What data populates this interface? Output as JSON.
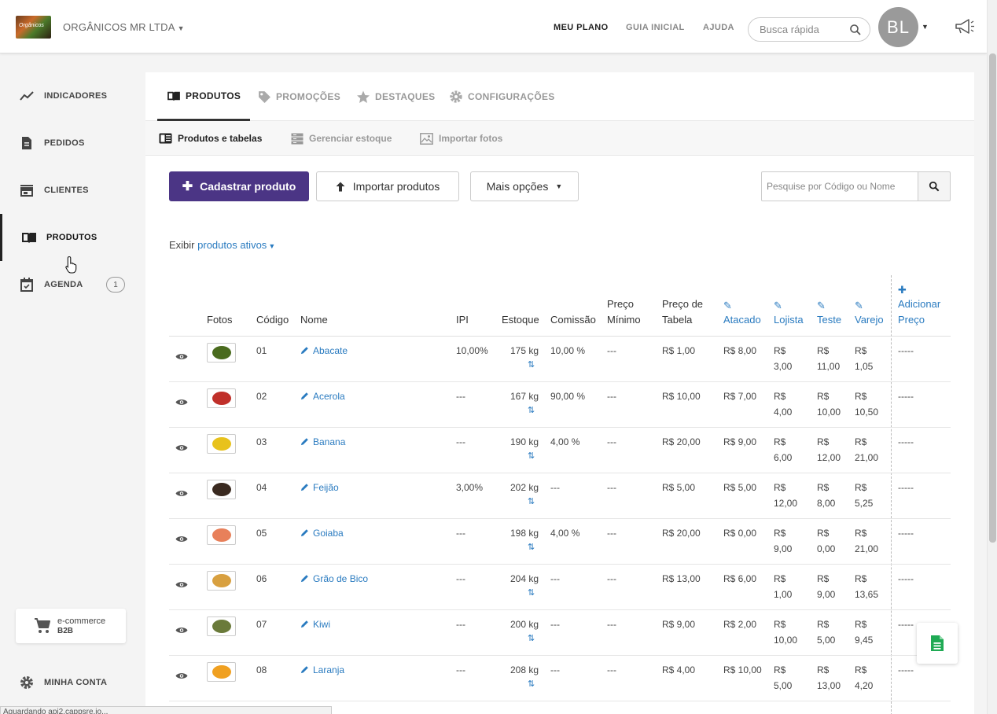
{
  "header": {
    "company": "ORGÂNICOS MR LTDA",
    "logo_text": "Orgânicos",
    "nav": [
      "MEU PLANO",
      "GUIA INICIAL",
      "AJUDA"
    ],
    "search_placeholder": "Busca rápida",
    "avatar_initials": "BL"
  },
  "sidebar": {
    "items": [
      {
        "label": "INDICADORES",
        "icon": "chart-line-icon"
      },
      {
        "label": "PEDIDOS",
        "icon": "document-icon"
      },
      {
        "label": "CLIENTES",
        "icon": "store-icon"
      },
      {
        "label": "PRODUTOS",
        "icon": "book-icon"
      },
      {
        "label": "AGENDA",
        "icon": "calendar-icon",
        "badge": "1"
      }
    ],
    "ecommerce": {
      "line1": "e-commerce",
      "line2": "B2B"
    },
    "account": "MINHA CONTA"
  },
  "tabs": [
    "PRODUTOS",
    "PROMOÇÕES",
    "DESTAQUES",
    "CONFIGURAÇÕES"
  ],
  "subtabs": [
    "Produtos e tabelas",
    "Gerenciar estoque",
    "Importar fotos"
  ],
  "actions": {
    "new_product": "Cadastrar produto",
    "import_products": "Importar produtos",
    "more_options": "Mais opções",
    "search_placeholder": "Pesquise por Código ou Nome"
  },
  "filter": {
    "prefix": "Exibir",
    "value": "produtos ativos"
  },
  "table": {
    "headers": {
      "photos": "Fotos",
      "code": "Código",
      "name": "Nome",
      "ipi": "IPI",
      "stock": "Estoque",
      "commission": "Comissão",
      "min_price_1": "Preço",
      "min_price_2": "Mínimo",
      "table_price_1": "Preço de",
      "table_price_2": "Tabela",
      "atacado": "Atacado",
      "lojista": "Lojista",
      "teste": "Teste",
      "varejo": "Varejo",
      "add_price_1": "Adicionar",
      "add_price_2": "Preço"
    },
    "rows": [
      {
        "code": "01",
        "name": "Abacate",
        "ipi": "10,00%",
        "stock": "175 kg",
        "commission": "10,00 %",
        "min": "---",
        "table": "R$ 1,00",
        "atacado": "R$ 8,00",
        "lojista_1": "R$",
        "lojista_2": "3,00",
        "teste_1": "R$",
        "teste_2": "11,00",
        "varejo_1": "R$",
        "varejo_2": "1,05",
        "extra": "-----",
        "color": "#4a6b1e"
      },
      {
        "code": "02",
        "name": "Acerola",
        "ipi": "---",
        "stock": "167 kg",
        "commission": "90,00 %",
        "min": "---",
        "table": "R$ 10,00",
        "atacado": "R$ 7,00",
        "lojista_1": "R$",
        "lojista_2": "4,00",
        "teste_1": "R$",
        "teste_2": "10,00",
        "varejo_1": "R$",
        "varejo_2": "10,50",
        "extra": "-----",
        "color": "#c0302a"
      },
      {
        "code": "03",
        "name": "Banana",
        "ipi": "---",
        "stock": "190 kg",
        "commission": "4,00 %",
        "min": "---",
        "table": "R$ 20,00",
        "atacado": "R$ 9,00",
        "lojista_1": "R$",
        "lojista_2": "6,00",
        "teste_1": "R$",
        "teste_2": "12,00",
        "varejo_1": "R$",
        "varejo_2": "21,00",
        "extra": "-----",
        "color": "#e8c21c"
      },
      {
        "code": "04",
        "name": "Feijão",
        "ipi": "3,00%",
        "stock": "202 kg",
        "commission": "---",
        "min": "---",
        "table": "R$ 5,00",
        "atacado": "R$ 5,00",
        "lojista_1": "R$",
        "lojista_2": "12,00",
        "teste_1": "R$",
        "teste_2": "8,00",
        "varejo_1": "R$",
        "varejo_2": "5,25",
        "extra": "-----",
        "color": "#3a2a20"
      },
      {
        "code": "05",
        "name": "Goiaba",
        "ipi": "---",
        "stock": "198 kg",
        "commission": "4,00 %",
        "min": "---",
        "table": "R$ 20,00",
        "atacado": "R$ 0,00",
        "lojista_1": "R$",
        "lojista_2": "9,00",
        "teste_1": "R$",
        "teste_2": "0,00",
        "varejo_1": "R$",
        "varejo_2": "21,00",
        "extra": "-----",
        "color": "#e8805a"
      },
      {
        "code": "06",
        "name": "Grão de Bico",
        "ipi": "---",
        "stock": "204 kg",
        "commission": "---",
        "min": "---",
        "table": "R$ 13,00",
        "atacado": "R$ 6,00",
        "lojista_1": "R$",
        "lojista_2": "1,00",
        "teste_1": "R$",
        "teste_2": "9,00",
        "varejo_1": "R$",
        "varejo_2": "13,65",
        "extra": "-----",
        "color": "#d8a040"
      },
      {
        "code": "07",
        "name": "Kiwi",
        "ipi": "---",
        "stock": "200 kg",
        "commission": "---",
        "min": "---",
        "table": "R$ 9,00",
        "atacado": "R$ 2,00",
        "lojista_1": "R$",
        "lojista_2": "10,00",
        "teste_1": "R$",
        "teste_2": "5,00",
        "varejo_1": "R$",
        "varejo_2": "9,45",
        "extra": "-----",
        "color": "#6a7a3a"
      },
      {
        "code": "08",
        "name": "Laranja",
        "ipi": "---",
        "stock": "208 kg",
        "commission": "---",
        "min": "---",
        "table": "R$ 4,00",
        "atacado": "R$ 10,00",
        "lojista_1": "R$",
        "lojista_2": "5,00",
        "teste_1": "R$",
        "teste_2": "13,00",
        "varejo_1": "R$",
        "varejo_2": "4,20",
        "extra": "-----",
        "color": "#f0a020"
      }
    ]
  },
  "status_text": "Aguardando api2.cappsre.io..."
}
